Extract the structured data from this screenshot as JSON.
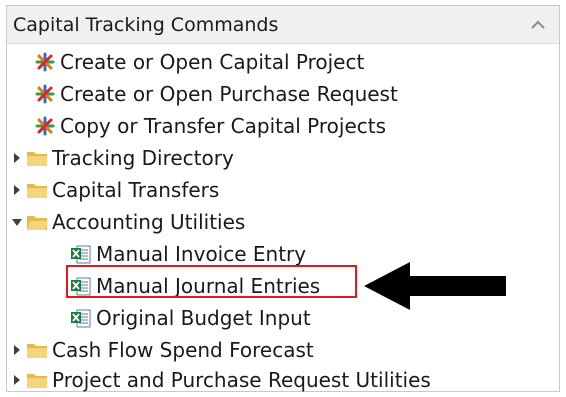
{
  "panel": {
    "title": "Capital Tracking Commands"
  },
  "items": [
    {
      "label": "Create or Open Capital Project",
      "icon": "capital-burst-icon"
    },
    {
      "label": "Create or Open Purchase Request",
      "icon": "capital-burst-icon"
    },
    {
      "label": "Copy or Transfer Capital Projects",
      "icon": "capital-burst-icon"
    },
    {
      "label": "Tracking Directory",
      "icon": "folder-icon",
      "state": "collapsed"
    },
    {
      "label": "Capital Transfers",
      "icon": "folder-icon",
      "state": "collapsed"
    },
    {
      "label": "Accounting Utilities",
      "icon": "folder-icon",
      "state": "expanded"
    },
    {
      "label": "Manual Invoice Entry",
      "icon": "excel-form-icon"
    },
    {
      "label": "Manual Journal Entries",
      "icon": "excel-form-icon",
      "highlighted": true
    },
    {
      "label": "Original Budget Input",
      "icon": "excel-form-icon"
    },
    {
      "label": "Cash Flow Spend Forecast",
      "icon": "folder-icon",
      "state": "collapsed"
    },
    {
      "label": "Project and Purchase Request Utilities",
      "icon": "folder-icon",
      "state": "collapsed"
    }
  ],
  "colors": {
    "highlight": "#e0191f",
    "folder": "#f2c55c",
    "excel": "#1f7a3f"
  }
}
